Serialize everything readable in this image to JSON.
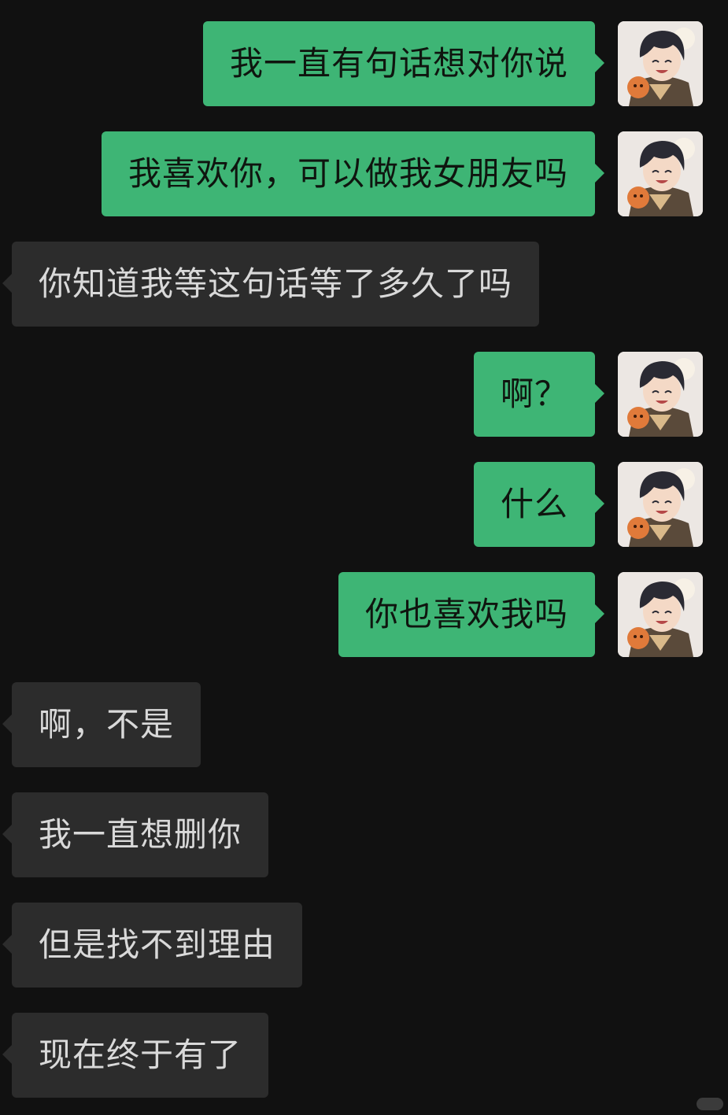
{
  "messages": [
    {
      "side": "me",
      "text": "我一直有句话想对你说",
      "avatar": "avatar-anime-boy-icon"
    },
    {
      "side": "me",
      "text": "我喜欢你，可以做我女朋友吗",
      "avatar": "avatar-anime-boy-icon"
    },
    {
      "side": "them",
      "text": "你知道我等这句话等了多久了吗"
    },
    {
      "side": "me",
      "text": "啊？",
      "avatar": "avatar-anime-boy-icon"
    },
    {
      "side": "me",
      "text": "什么",
      "avatar": "avatar-anime-boy-icon"
    },
    {
      "side": "me",
      "text": "你也喜欢我吗",
      "avatar": "avatar-anime-boy-icon"
    },
    {
      "side": "them",
      "text": "啊，不是"
    },
    {
      "side": "them",
      "text": "我一直想删你"
    },
    {
      "side": "them",
      "text": "但是找不到理由"
    },
    {
      "side": "them",
      "text": "现在终于有了"
    }
  ],
  "colors": {
    "background": "#111111",
    "my_bubble": "#3eb575",
    "their_bubble": "#2c2c2c"
  }
}
